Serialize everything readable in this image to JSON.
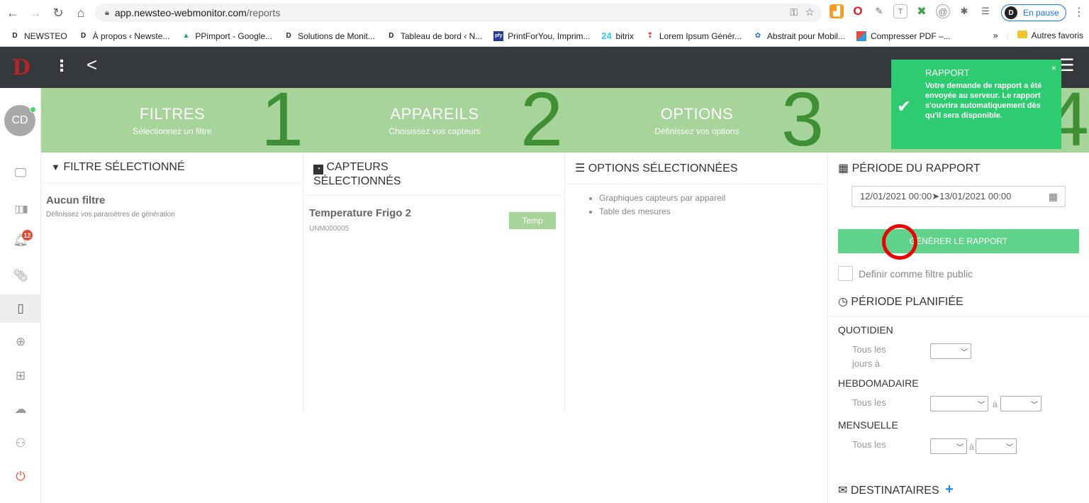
{
  "browser": {
    "url_domain": "app.newsteo-webmonitor.com",
    "url_path": "/reports",
    "profile_status": "En pause",
    "bookmarks": [
      {
        "label": "NEWSTEO"
      },
      {
        "label": "À propos ‹ Newste..."
      },
      {
        "label": "PPimport - Google..."
      },
      {
        "label": "Solutions de Monit..."
      },
      {
        "label": "Tableau de bord ‹ N..."
      },
      {
        "label": "PrintForYou, Imprim..."
      },
      {
        "label": "bitrix"
      },
      {
        "label": "Lorem Ipsum Génér..."
      },
      {
        "label": "Abstrait pour Mobil..."
      },
      {
        "label": "Compresser PDF –..."
      }
    ],
    "bookmarks_more": "»",
    "other_bookmarks": "Autres favoris"
  },
  "user": {
    "initials": "CD"
  },
  "notifications": {
    "count": "12"
  },
  "steps": [
    {
      "num": "1",
      "title": "FILTRES",
      "sub": "Sélectionnez un filtre"
    },
    {
      "num": "2",
      "title": "APPAREILS",
      "sub": "Choisissez vos capteurs"
    },
    {
      "num": "3",
      "title": "OPTIONS",
      "sub": "Définissez vos options"
    },
    {
      "num": "4"
    }
  ],
  "filter": {
    "header": "FILTRE SÉLECTIONNÉ",
    "name": "Aucun filtre",
    "desc": "Définissez vos paramètres de génération"
  },
  "sensors": {
    "header_line1": "CAPTEURS",
    "header_line2": "SÉLECTIONNÉS",
    "items": [
      {
        "name": "Temperature Frigo 2",
        "id": "UNM000005",
        "tag": "Temp"
      }
    ]
  },
  "options": {
    "header": "OPTIONS SÉLECTIONNÉES",
    "items": [
      "Graphiques capteurs par appareil",
      "Table des mesures"
    ]
  },
  "report": {
    "period_header": "PÉRIODE DU RAPPORT",
    "date_range": "12/01/2021 00:00➤13/01/2021 00:00",
    "generate_label": "GÉNÉRER LE RAPPORT",
    "public_filter_label": "Definir comme filtre public",
    "planned_header": "PÉRIODE PLANIFIÉE",
    "daily_label": "QUOTIDIEN",
    "daily_sub_line1": "Tous les",
    "daily_sub_line2": "jours à",
    "weekly_label": "HEBDOMADAIRE",
    "weekly_sub": "Tous les",
    "monthly_label": "MENSUELLE",
    "monthly_sub": "Tous les",
    "at_label": "à",
    "recipients_header": "DESTINATAIRES",
    "add_symbol": "+"
  },
  "toast": {
    "title": "RAPPORT",
    "close": "×",
    "message": "Votre demande de rapport a été envoyée au serveur. Le rapport s'ouvrira automatiquement dès qu'il sera disponible."
  },
  "colors": {
    "banner_green": "#a6d49a",
    "step_number_green": "#3f8f34",
    "button_green": "#5fd38a",
    "toast_green": "#2ecc71",
    "header_dark": "#35383d",
    "highlight_red": "#ee0000"
  }
}
